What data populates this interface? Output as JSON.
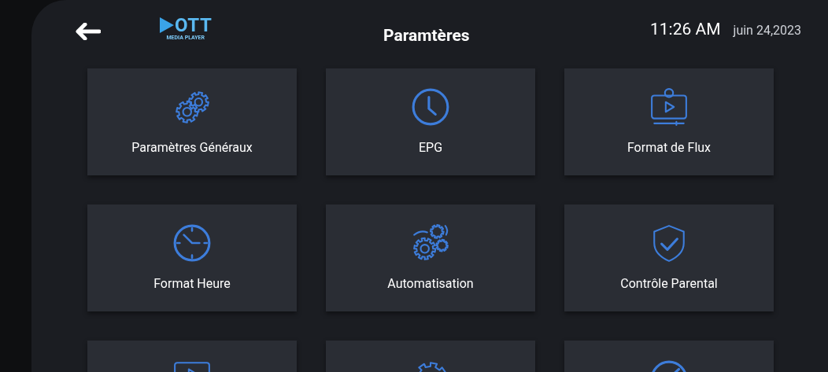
{
  "header": {
    "logo": {
      "mark": "OTT",
      "subtitle": "MEDIA PLAYER"
    },
    "title": "Paramtères",
    "time": "11:26 AM",
    "date": "juin 24,2023"
  },
  "tiles": [
    {
      "kind": "labeled",
      "label": "Paramètres Généraux"
    },
    {
      "kind": "labeled",
      "label": "EPG"
    },
    {
      "kind": "labeled",
      "label": "Format de Flux"
    },
    {
      "kind": "labeled",
      "label": "Format Heure"
    },
    {
      "kind": "labeled",
      "label": "Automatisation"
    },
    {
      "kind": "labeled",
      "label": "Contrôle Parental"
    },
    {
      "kind": "icon_only"
    },
    {
      "kind": "icon_only"
    },
    {
      "kind": "icon_only"
    }
  ]
}
